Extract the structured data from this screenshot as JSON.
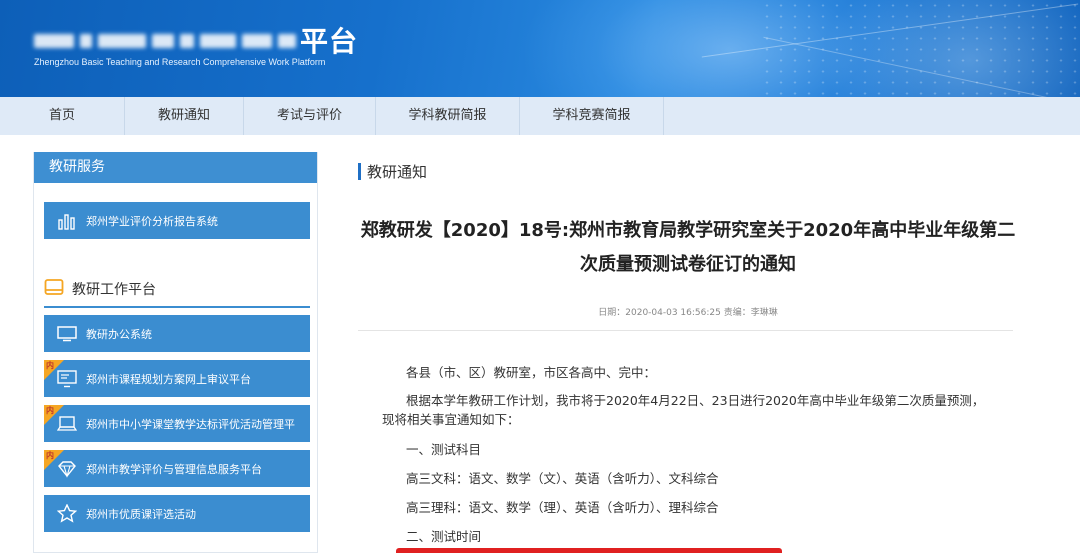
{
  "banner": {
    "title_visible": "平台",
    "subtitle": "Zhengzhou Basic Teaching and Research Comprehensive Work Platform"
  },
  "nav": {
    "items": [
      "首页",
      "教研通知",
      "考试与评价",
      "学科教研简报",
      "学科竞赛简报"
    ]
  },
  "sidebar": {
    "header": "教研服务",
    "top_item": {
      "label": "郑州学业评价分析报告系统",
      "icon": "bar-chart-icon"
    },
    "section_title": "教研工作平台",
    "section_icon": "folder-icon",
    "items": [
      {
        "label": "教研办公系统",
        "icon": "monitor-icon",
        "tag": ""
      },
      {
        "label": "郑州市课程规划方案网上审议平台",
        "icon": "screen-icon",
        "tag": "内"
      },
      {
        "label": "郑州市中小学课堂教学达标评优活动管理平",
        "icon": "laptop-icon",
        "tag": "内"
      },
      {
        "label": "郑州市教学评价与管理信息服务平台",
        "icon": "diamond-icon",
        "tag": "内"
      },
      {
        "label": "郑州市优质课评选活动",
        "icon": "star-icon",
        "tag": ""
      }
    ]
  },
  "main": {
    "breadcrumb": "教研通知",
    "title_line1": "郑教研发【2020】18号:郑州市教育局教学研究室关于2020年高中毕业年级第二",
    "title_line2": "次质量预测试卷征订的通知",
    "meta": "日期：2020-04-03 16:56:25  责编：李琳琳",
    "paragraphs": [
      "各县（市、区）教研室，市区各高中、完中：",
      "根据本学年教研工作计划，我市将于2020年4月22日、23日进行2020年高中毕业年级第二次质量预测，现将相关事宜通知如下：",
      "一、测试科目",
      "高三文科：语文、数学（文）、英语（含听力）、文科综合",
      "高三理科：语文、数学（理）、英语（含听力）、理科综合",
      "二、测试时间"
    ]
  },
  "colors": {
    "banner_blue": "#1670cc",
    "nav_bg": "#dfeaf7",
    "sidebar_button": "#3b8dd0",
    "tag_orange": "#f5a623",
    "accent_red": "#e02020"
  }
}
